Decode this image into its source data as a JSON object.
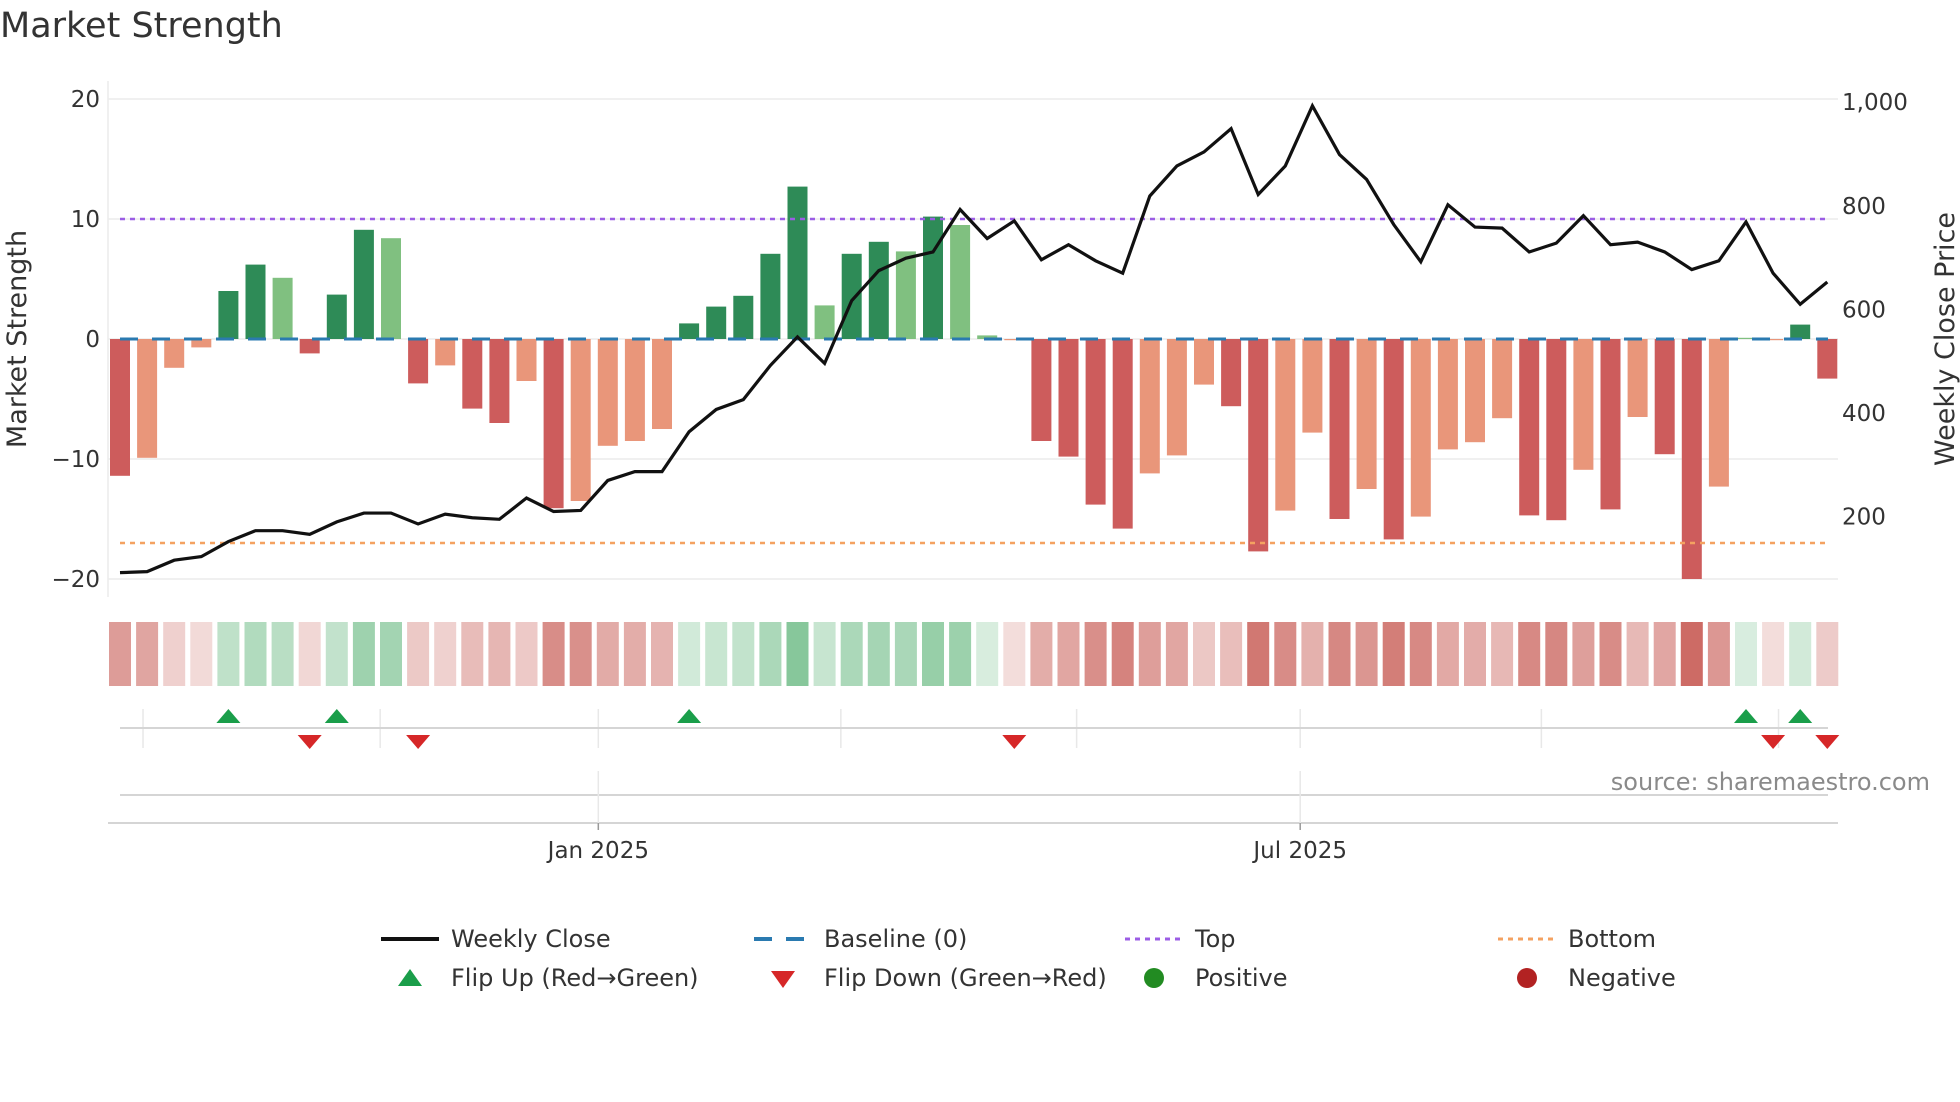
{
  "title": "Market Strength",
  "source": "source: sharemaestro.com",
  "colors": {
    "dark_red": "#cd5c5c",
    "light_red": "#e9967a",
    "dark_green": "#2e8b57",
    "light_green": "#80c080",
    "close": "#111111",
    "baseline": "#2a7ab0",
    "top": "#9b5de5",
    "bottom": "#f4a261",
    "flip_up": "#1a9e4a",
    "flip_down": "#d62728",
    "positive": "#228b22",
    "negative": "#b22222"
  },
  "legend": [
    {
      "label": "Weekly Close",
      "icon": "solid-line"
    },
    {
      "label": "Baseline (0)",
      "icon": "dashed-line"
    },
    {
      "label": "Top",
      "icon": "dotted-line-purple"
    },
    {
      "label": "Bottom",
      "icon": "dotted-line-orange"
    },
    {
      "label": "Flip Up (Red→Green)",
      "icon": "triangle-up"
    },
    {
      "label": "Flip Down (Green→Red)",
      "icon": "triangle-down"
    },
    {
      "label": "Positive",
      "icon": "circle-green"
    },
    {
      "label": "Negative",
      "icon": "circle-red"
    }
  ],
  "chart_data": {
    "type": "bar",
    "title": "Market Strength",
    "ylabel": "Market Strength",
    "y2label": "Weekly Close Price",
    "ylim": [
      -21.5,
      21.5
    ],
    "y2lim": [
      45,
      1041
    ],
    "yticks": [
      20,
      10,
      0,
      -10,
      -20
    ],
    "ytick_labels": [
      "20",
      "10",
      "0",
      "−10",
      "−20"
    ],
    "y2ticks": [
      1000,
      800,
      600,
      400,
      200
    ],
    "y2tick_labels": [
      "1,000",
      "800",
      "600",
      "400",
      "200"
    ],
    "xtick_labels": [
      {
        "label": "Jan 2025",
        "index": 17.65
      },
      {
        "label": "Jul 2025",
        "index": 43.55
      }
    ],
    "month_grid_index": [
      0.85,
      9.6,
      17.65,
      26.6,
      35.3,
      43.55,
      52.45,
      61.2
    ],
    "top": 10,
    "bottom": -17,
    "baseline": 0,
    "strength": [
      -11.4,
      -9.9,
      -2.4,
      -0.7,
      4.0,
      6.2,
      5.1,
      -1.2,
      3.7,
      9.1,
      8.4,
      -3.7,
      -2.2,
      -5.8,
      -7.0,
      -3.5,
      -14.1,
      -13.5,
      -8.9,
      -8.5,
      -7.5,
      1.3,
      2.7,
      3.6,
      7.1,
      12.7,
      2.8,
      7.1,
      8.1,
      7.3,
      10.2,
      9.5,
      0.3,
      -0.1,
      -8.5,
      -9.8,
      -13.8,
      -15.8,
      -11.2,
      -9.7,
      -3.8,
      -5.6,
      -17.7,
      -14.3,
      -7.8,
      -15.0,
      -12.5,
      -16.7,
      -14.8,
      -9.2,
      -8.6,
      -6.6,
      -14.7,
      -15.1,
      -10.9,
      -14.2,
      -6.5,
      -9.6,
      -20.0,
      -12.3,
      0.1,
      -0.1,
      1.2,
      -3.3
    ],
    "shade": [
      "d",
      "l",
      "l",
      "l",
      "d",
      "d",
      "l",
      "d",
      "d",
      "d",
      "l",
      "d",
      "l",
      "d",
      "d",
      "l",
      "d",
      "l",
      "l",
      "l",
      "l",
      "d",
      "d",
      "d",
      "d",
      "d",
      "l",
      "d",
      "d",
      "l",
      "d",
      "l",
      "l",
      "l",
      "d",
      "d",
      "d",
      "d",
      "l",
      "l",
      "l",
      "d",
      "d",
      "l",
      "l",
      "d",
      "l",
      "d",
      "l",
      "l",
      "l",
      "l",
      "d",
      "d",
      "l",
      "d",
      "l",
      "d",
      "d",
      "l",
      "l",
      "l",
      "d",
      "d"
    ],
    "weekly_close": [
      92,
      94,
      116,
      123,
      152,
      173,
      173,
      166,
      190,
      207,
      207,
      186,
      205,
      198,
      195,
      236,
      210,
      212,
      270,
      287,
      287,
      364,
      407,
      426,
      492,
      547,
      496,
      617,
      675,
      699,
      711,
      793,
      737,
      771,
      696,
      725,
      694,
      670,
      819,
      877,
      904,
      949,
      822,
      877,
      993,
      899,
      851,
      764,
      692,
      802,
      759,
      757,
      711,
      728,
      781,
      725,
      730,
      711,
      677,
      694,
      769,
      670,
      610,
      653
    ],
    "flip_up": [
      5,
      9,
      22,
      61,
      63
    ],
    "flip_down": [
      8,
      12,
      34,
      62,
      64
    ]
  }
}
